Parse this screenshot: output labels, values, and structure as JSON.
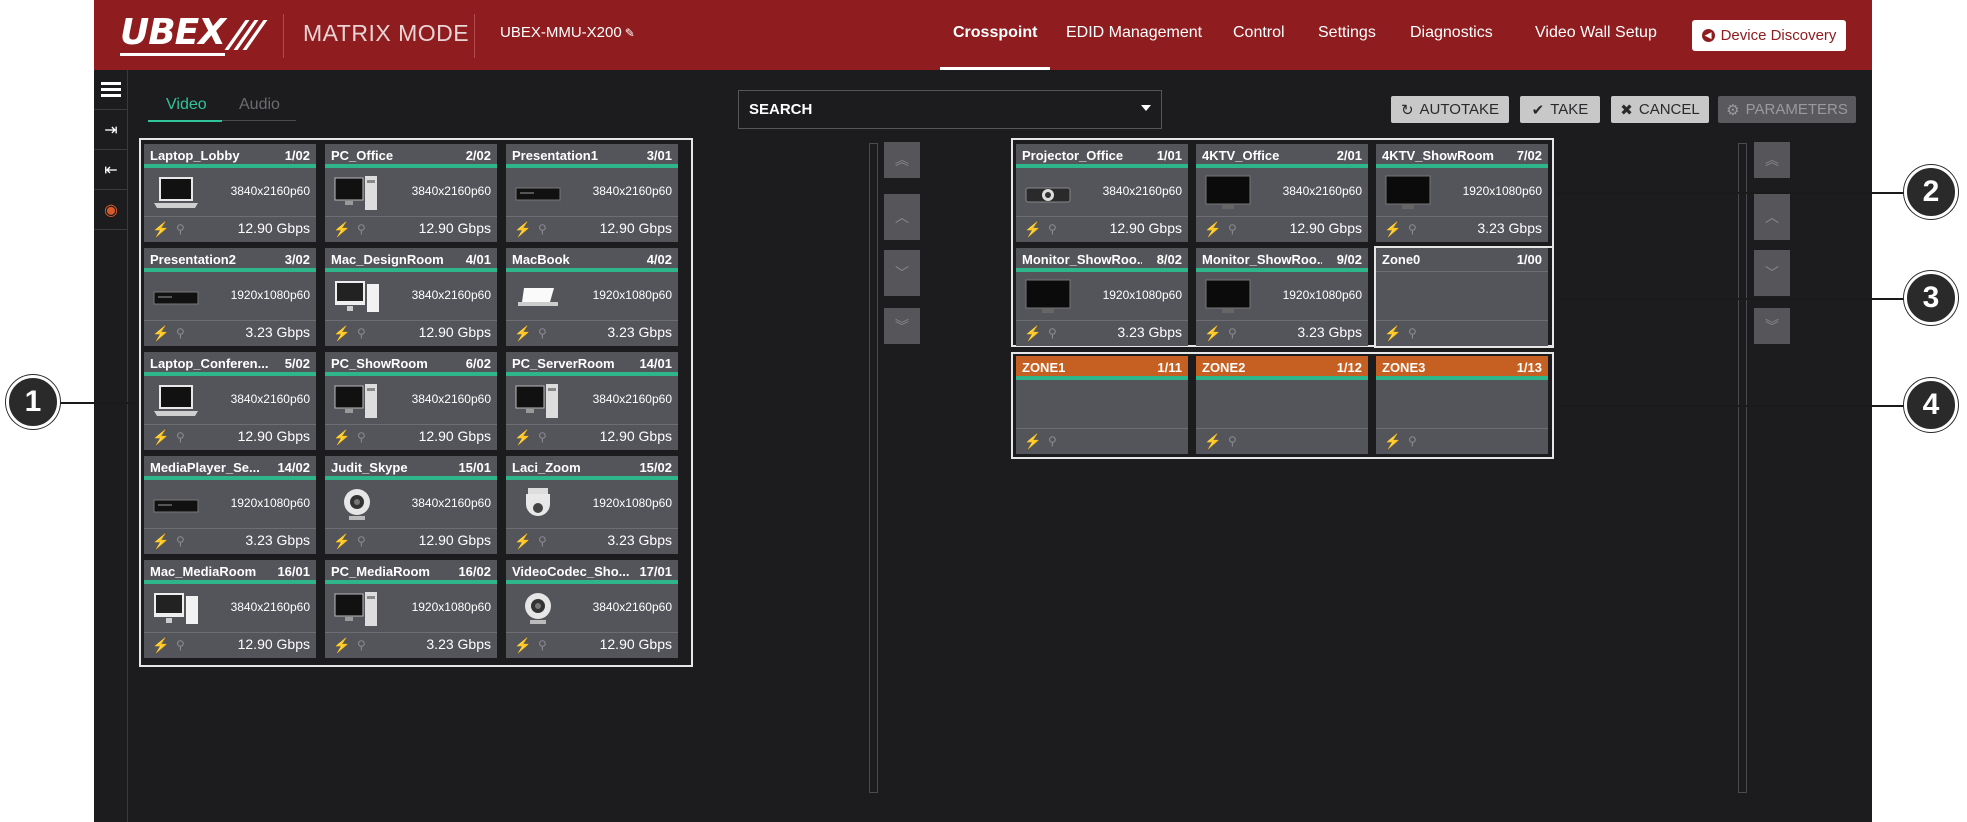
{
  "header": {
    "logo_text": "UBEX",
    "mode": "MATRIX MODE",
    "device_name": "UBEX-MMU-X200",
    "nav": [
      "Crosspoint",
      "EDID Management",
      "Control",
      "Settings",
      "Diagnostics",
      "Video Wall Setup"
    ],
    "active_nav": "Crosspoint",
    "discovery_label": "Device Discovery"
  },
  "tabs": {
    "video": "Video",
    "audio": "Audio",
    "active": "Video"
  },
  "search": {
    "label": "SEARCH"
  },
  "actions": {
    "autotake": "AUTOTAKE",
    "take": "TAKE",
    "cancel": "CANCEL",
    "parameters": "PARAMETERS"
  },
  "sources": [
    {
      "name": "Laptop_Lobby",
      "port": "1/02",
      "res": "3840x2160p60",
      "bw": "12.90 Gbps",
      "icon": "laptop-icon"
    },
    {
      "name": "PC_Office",
      "port": "2/02",
      "res": "3840x2160p60",
      "bw": "12.90 Gbps",
      "icon": "desktop-pc-icon"
    },
    {
      "name": "Presentation1",
      "port": "3/01",
      "res": "3840x2160p60",
      "bw": "12.90 Gbps",
      "icon": "media-player-icon"
    },
    {
      "name": "Presentation2",
      "port": "3/02",
      "res": "1920x1080p60",
      "bw": "3.23 Gbps",
      "icon": "media-player-icon"
    },
    {
      "name": "Mac_DesignRoom",
      "port": "4/01",
      "res": "3840x2160p60",
      "bw": "12.90 Gbps",
      "icon": "imac-icon"
    },
    {
      "name": "MacBook",
      "port": "4/02",
      "res": "1920x1080p60",
      "bw": "3.23 Gbps",
      "icon": "macbook-icon"
    },
    {
      "name": "Laptop_Conferen...",
      "port": "5/02",
      "res": "3840x2160p60",
      "bw": "12.90 Gbps",
      "icon": "laptop-icon"
    },
    {
      "name": "PC_ShowRoom",
      "port": "6/02",
      "res": "3840x2160p60",
      "bw": "12.90 Gbps",
      "icon": "desktop-pc-icon"
    },
    {
      "name": "PC_ServerRoom",
      "port": "14/01",
      "res": "3840x2160p60",
      "bw": "12.90 Gbps",
      "icon": "desktop-pc-icon"
    },
    {
      "name": "MediaPlayer_Se...",
      "port": "14/02",
      "res": "1920x1080p60",
      "bw": "3.23 Gbps",
      "icon": "media-player-icon"
    },
    {
      "name": "Judit_Skype",
      "port": "15/01",
      "res": "3840x2160p60",
      "bw": "12.90 Gbps",
      "icon": "webcam-icon"
    },
    {
      "name": "Laci_Zoom",
      "port": "15/02",
      "res": "1920x1080p60",
      "bw": "3.23 Gbps",
      "icon": "dome-camera-icon"
    },
    {
      "name": "Mac_MediaRoom",
      "port": "16/01",
      "res": "3840x2160p60",
      "bw": "12.90 Gbps",
      "icon": "imac-icon"
    },
    {
      "name": "PC_MediaRoom",
      "port": "16/02",
      "res": "1920x1080p60",
      "bw": "3.23 Gbps",
      "icon": "desktop-pc-icon"
    },
    {
      "name": "VideoCodec_Sho...",
      "port": "17/01",
      "res": "3840x2160p60",
      "bw": "12.90 Gbps",
      "icon": "webcam-icon"
    }
  ],
  "destinations": [
    {
      "name": "Projector_Office",
      "port": "1/01",
      "res": "3840x2160p60",
      "bw": "12.90 Gbps",
      "icon": "projector-icon"
    },
    {
      "name": "4KTV_Office",
      "port": "2/01",
      "res": "3840x2160p60",
      "bw": "12.90 Gbps",
      "icon": "tv-icon"
    },
    {
      "name": "4KTV_ShowRoom",
      "port": "7/02",
      "res": "1920x1080p60",
      "bw": "3.23 Gbps",
      "icon": "tv-icon"
    },
    {
      "name": "Monitor_ShowRoo...",
      "port": "8/02",
      "res": "1920x1080p60",
      "bw": "3.23 Gbps",
      "icon": "tv-icon"
    },
    {
      "name": "Monitor_ShowRoo...",
      "port": "9/02",
      "res": "1920x1080p60",
      "bw": "3.23 Gbps",
      "icon": "tv-icon"
    }
  ],
  "zone0": {
    "name": "Zone0",
    "port": "1/00"
  },
  "zones": [
    {
      "name": "ZONE1",
      "port": "1/11"
    },
    {
      "name": "ZONE2",
      "port": "1/12"
    },
    {
      "name": "ZONE3",
      "port": "1/13"
    }
  ],
  "callouts": [
    "1",
    "2",
    "3",
    "4"
  ],
  "colors": {
    "header": "#8f1d20",
    "accent": "#2fb58a",
    "zone": "#c65f22",
    "plug": "#e7d11a"
  }
}
